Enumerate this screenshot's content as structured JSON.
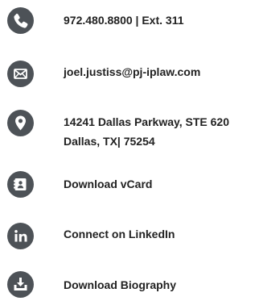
{
  "contact": {
    "phone": {
      "icon": "phone-icon",
      "label": "972.480.8800 | Ext. 311"
    },
    "email": {
      "icon": "envelope-icon",
      "label": "joel.justiss@pj-iplaw.com"
    },
    "address": {
      "icon": "map-pin-icon",
      "line1": "14241 Dallas Parkway, STE 620",
      "line2": "Dallas, TX| 75254"
    },
    "vcard": {
      "icon": "contact-card-icon",
      "label": "Download vCard"
    },
    "linkedin": {
      "icon": "linkedin-icon",
      "label": "Connect on LinkedIn"
    },
    "biography": {
      "icon": "download-icon",
      "label": "Download Biography"
    }
  },
  "colors": {
    "icon_background": "#4d5257",
    "icon_foreground": "#ffffff",
    "text": "#222222"
  }
}
